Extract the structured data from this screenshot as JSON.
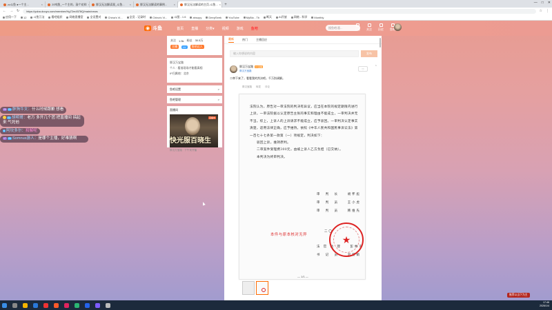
{
  "browser": {
    "tabs": [
      {
        "label": "zz斗鱼 ●一个主..."
      },
      {
        "label": "20吨鱼_一个主的、敲个花样"
      },
      {
        "label": "胖汉无法解读观_斗鱼..."
      },
      {
        "label": "胖汉无法解读的事例..."
      },
      {
        "label": "胖汉无法解读的主页-斗鱼..."
      }
    ],
    "new_tab": "+",
    "window_controls": [
      "—",
      "□",
      "✕"
    ],
    "url": "https://yuba.douyu.com/member/Hg72m4578Q/main/news",
    "bookmarks": [
      "应用一下",
      "12",
      "斗鱼万法",
      "看吧组织",
      "网络直播室",
      "全设置对",
      "China's Vi...",
      "全员 - 记录时",
      "China's Vi...",
      "斗图 - 1.6",
      "ahsopy",
      "DeepSeek",
      "YouTube",
      "MyBio - Tb",
      "断天",
      "AI开放",
      "网络 - 科学",
      "Monthly"
    ],
    "right_search": "2026年第一个工作"
  },
  "site": {
    "logo_text": "斗鱼",
    "nav": [
      "首页",
      "直播",
      "分类▾",
      "视频",
      "游戏",
      "鱼吧"
    ],
    "hot_index": 5,
    "search_placeholder": "搜鱼吧/直...",
    "header_icons": [
      "下载",
      "关注",
      "历史",
      "鱼吧"
    ]
  },
  "profile": {
    "stats": [
      {
        "label": "关注",
        "value": "1.5k"
      },
      {
        "label": "粉丝",
        "value": "30.5万"
      }
    ],
    "badges": [
      "主播",
      "LV",
      "鱼吧达人"
    ],
    "info_lines": [
      "胖汉万宝路",
      "个人 · 看准现场才能看真相",
      "IP归属地：北京"
    ],
    "menu_items": [
      "鱼吧设置",
      "鱼吧管理"
    ],
    "live_section_title": "直播间",
    "live_caption": "快光服百晓生",
    "live_tag": "直播中",
    "live_footer": "胖汉万宝路 · 下午来开播",
    "right_mark": ">"
  },
  "feed": {
    "tabs": [
      "最新",
      "热门",
      "主播回应"
    ],
    "active_tab": 0,
    "post_placeholder": "输入你想说的内容",
    "post_button": "发布",
    "author": {
      "name": "胖汉万宝路",
      "level": "LV.主播",
      "group": "胖汉万宝路"
    },
    "follow_label": "♡",
    "post_text": "二审下来了，看看我的判决吧，千万别调解。",
    "post_meta": [
      "胖汉宝路",
      "转发",
      "评论"
    ],
    "document": {
      "body": [
        "法院认为，原告对一审法院的判决有异议，应当在本院的规定期限内进行上诉，一审法院据以认定原告主张的事实和理由不能成立，一审判决并无不当。综上，上诉人的上诉请求不能成立，应予驳回。一审判决认定事实清楚，适用法律正确，应予维持。依照《中华人民共和国民事诉讼法》第一百七十七条第一款第（一）项规定，判决如下："
      ],
      "rulings": [
        "驳回上诉，维持原判。",
        "二审案件受理费300元，由被上诉人乙方负担（已交纳）。",
        "本判决为终审判决。"
      ],
      "signatures": [
        "审　判　长　　胡怀彪",
        "审　判　员　　王小虎",
        "审　判　员　　韩维先"
      ],
      "clerk": [
        "法 官 助 理　　彭林海",
        "书　记　员　　刘丽娟"
      ],
      "stamp_text": "本件与原本核对无异",
      "seal_text": "北京市第四中级人民法院",
      "date_partial": "二〇",
      "page_label": "— 1/1 —"
    }
  },
  "chat": [
    {
      "badge1": "20",
      "badge2": "21",
      "user": "胖狗牛文：",
      "text": "什么时候跟歉 想看"
    },
    {
      "badge1": "20",
      "badge2": "21",
      "user": "胡明哥：",
      "text": "老万 多开几个团 把直播间 搞起来 气死他"
    },
    {
      "badge1": "",
      "badge2": "6",
      "user": "阿坎多尔：",
      "text": "和解呢",
      "pink": true
    },
    {
      "badge1": "17",
      "badge2": "26",
      "user": "Somnus游人：",
      "text": "是哪个主播，好难猜啊"
    }
  ],
  "taskbar": {
    "notice": "推荐以当下为主",
    "time": "17:46",
    "date": "2026/1/4"
  }
}
